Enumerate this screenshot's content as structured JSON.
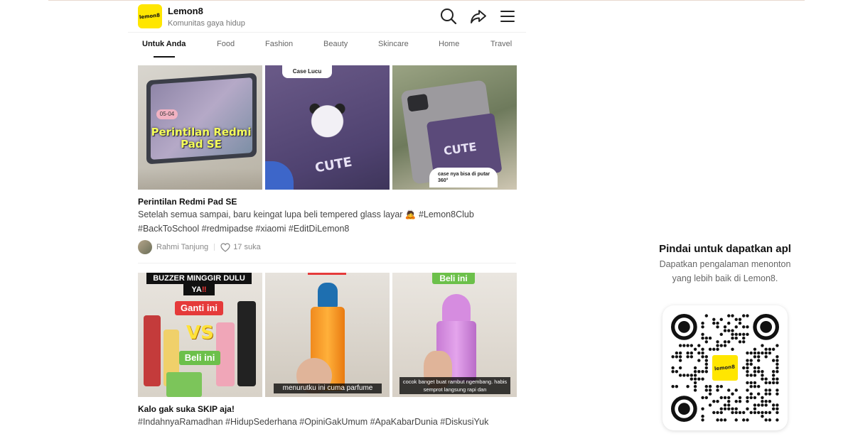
{
  "app": {
    "logo_text": "lemon8",
    "brand": "Lemon8",
    "tagline": "Komunitas gaya hidup"
  },
  "header_icons": [
    "search-icon",
    "share-icon",
    "menu-icon"
  ],
  "tabs": [
    {
      "label": "Untuk Anda",
      "active": true
    },
    {
      "label": "Food"
    },
    {
      "label": "Fashion"
    },
    {
      "label": "Beauty"
    },
    {
      "label": "Skincare"
    },
    {
      "label": "Home"
    },
    {
      "label": "Travel"
    }
  ],
  "posts": [
    {
      "images": [
        {
          "overlay": "Perintilan Redmi Pad SE",
          "date": "05-04"
        },
        {
          "overlay": "Case Lucu",
          "text2": "CUTE"
        },
        {
          "overlay": "case nya bisa di putar 360°",
          "text2": "CUTE"
        }
      ],
      "title": "Perintilan Redmi Pad SE",
      "description": "Setelah semua sampai, baru keingat lupa beli tempered glass layar 🙇 #Lemon8Club #BackToSchool #redmipadse #xiaomi #EditDiLemon8",
      "author": "Rahmi Tanjung",
      "likes": "17 suka"
    },
    {
      "images": [
        {
          "overlay": "BUZZER MINGGIR DULU",
          "overlay_line2": "YA",
          "overlay_mark": "‼",
          "ganti": "Ganti ini",
          "vs": "VS",
          "beli": "Beli ini"
        },
        {
          "caption": "menurutku ini cuma parfume"
        },
        {
          "label": "Beli ini",
          "caption": "cocok banget buat rambut ngembang. habis semprot langsung rapi dan"
        }
      ],
      "title": "Kalo gak suka SKIP aja!",
      "description": "#IndahnyaRamadhan #HidupSederhana #OpiniGakUmum #ApaKabarDunia #DiskusiYuk"
    }
  ],
  "sidebar": {
    "title": "Pindai untuk dapatkan apl",
    "description": "Dapatkan pengalaman menonton yang lebih baik di Lemon8.",
    "qr_logo_text": "lemon8"
  },
  "colors": {
    "brand_yellow": "#ffe600",
    "active_tab": "#111111",
    "muted_text": "#777777"
  }
}
